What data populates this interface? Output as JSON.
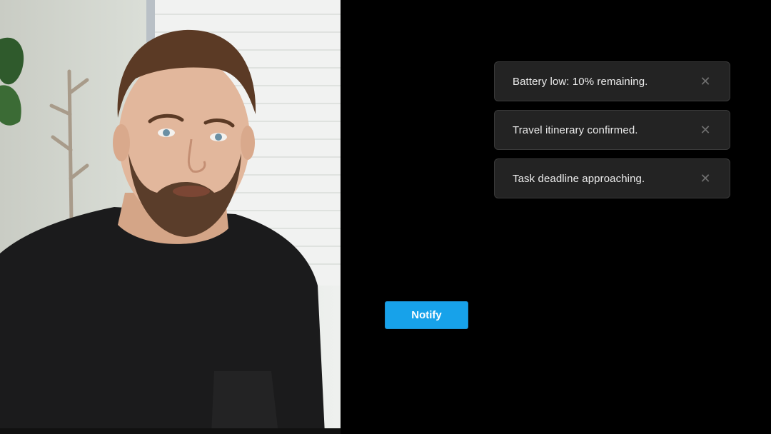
{
  "notifications": [
    {
      "message": "Battery low: 10% remaining.",
      "close_icon": "close-icon"
    },
    {
      "message": "Travel itinerary confirmed.",
      "close_icon": "close-icon"
    },
    {
      "message": "Task deadline approaching.",
      "close_icon": "close-icon"
    }
  ],
  "notify_button": {
    "label": "Notify"
  },
  "close_glyph": "✕",
  "colors": {
    "background": "#000000",
    "toast_background": "#232323",
    "toast_border": "#3a3a3a",
    "toast_text": "#ececec",
    "close_icon": "#6f6f6f",
    "accent": "#17a2ea"
  }
}
